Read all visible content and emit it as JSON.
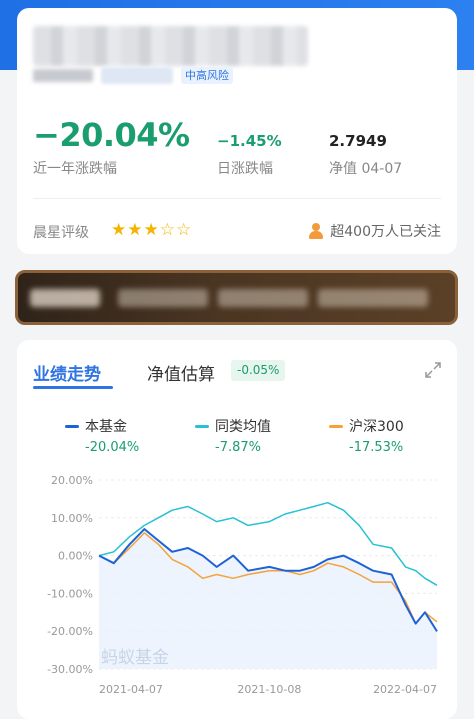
{
  "header": {
    "risk_tag": "中高风险"
  },
  "summary": {
    "return_1y": "−20.04%",
    "return_1y_label": "近一年涨跌幅",
    "daily_change": "−1.45%",
    "daily_change_label": "日涨跌幅",
    "nav": "2.7949",
    "nav_label": "净值 04-07",
    "rating_label": "晨星评级",
    "rating_stars": 3,
    "rating_max": 5,
    "followers": "超400万人已关注"
  },
  "chart_tabs": {
    "performance": "业绩走势",
    "estimate": "净值估算",
    "estimate_badge": "-0.05%"
  },
  "legend": [
    {
      "name": "本基金",
      "value": "-20.04%",
      "color": "#1e63d6"
    },
    {
      "name": "同类均值",
      "value": "-7.87%",
      "color": "#26c1d4"
    },
    {
      "name": "沪深300",
      "value": "-17.53%",
      "color": "#f4a23a"
    }
  ],
  "watermark": "蚂蚁基金",
  "colors": {
    "accent": "#2f74e0",
    "negative": "#1a9d6f",
    "fund": "#1e63d6",
    "category": "#26c1d4",
    "index": "#f4a23a"
  },
  "chart_data": {
    "type": "line",
    "y_ticks": [
      "20.00%",
      "10.00%",
      "0.00%",
      "-10.00%",
      "-20.00%",
      "-30.00%"
    ],
    "x_ticks": [
      "2021-04-07",
      "2021-10-08",
      "2022-04-07"
    ],
    "ylim": [
      -30,
      20
    ],
    "xlim": [
      "2021-04-07",
      "2022-04-07"
    ],
    "grid": true,
    "series": [
      {
        "name": "本基金",
        "x": [
          "2021-04-07",
          "2021-04-23",
          "2021-05-10",
          "2021-05-26",
          "2021-06-10",
          "2021-06-25",
          "2021-07-12",
          "2021-07-28",
          "2021-08-12",
          "2021-08-30",
          "2021-09-15",
          "2021-10-08",
          "2021-10-25",
          "2021-11-10",
          "2021-11-25",
          "2021-12-10",
          "2021-12-27",
          "2022-01-13",
          "2022-01-28",
          "2022-02-17",
          "2022-03-04",
          "2022-03-15",
          "2022-03-25",
          "2022-04-07"
        ],
        "values": [
          0,
          -2,
          3,
          7,
          4,
          1,
          2,
          0,
          -3,
          0,
          -4,
          -3,
          -4,
          -4,
          -3,
          -1,
          0,
          -2,
          -4,
          -5,
          -13,
          -18,
          -15,
          -20.04
        ]
      },
      {
        "name": "同类均值",
        "x": [
          "2021-04-07",
          "2021-04-23",
          "2021-05-10",
          "2021-05-26",
          "2021-06-10",
          "2021-06-25",
          "2021-07-12",
          "2021-07-28",
          "2021-08-12",
          "2021-08-30",
          "2021-09-15",
          "2021-10-08",
          "2021-10-25",
          "2021-11-10",
          "2021-11-25",
          "2021-12-10",
          "2021-12-27",
          "2022-01-13",
          "2022-01-28",
          "2022-02-17",
          "2022-03-04",
          "2022-03-15",
          "2022-03-25",
          "2022-04-07"
        ],
        "values": [
          0,
          1,
          5,
          8,
          10,
          12,
          13,
          11,
          9,
          10,
          8,
          9,
          11,
          12,
          13,
          14,
          12,
          8,
          3,
          2,
          -3,
          -4,
          -6,
          -7.87
        ]
      },
      {
        "name": "沪深300",
        "x": [
          "2021-04-07",
          "2021-04-23",
          "2021-05-10",
          "2021-05-26",
          "2021-06-10",
          "2021-06-25",
          "2021-07-12",
          "2021-07-28",
          "2021-08-12",
          "2021-08-30",
          "2021-09-15",
          "2021-10-08",
          "2021-10-25",
          "2021-11-10",
          "2021-11-25",
          "2021-12-10",
          "2021-12-27",
          "2022-01-13",
          "2022-01-28",
          "2022-02-17",
          "2022-03-04",
          "2022-03-15",
          "2022-03-25",
          "2022-04-07"
        ],
        "values": [
          0,
          -2,
          2,
          6,
          3,
          -1,
          -3,
          -6,
          -5,
          -6,
          -5,
          -4,
          -4,
          -5,
          -4,
          -2,
          -3,
          -5,
          -7,
          -7,
          -12,
          -18,
          -15,
          -17.53
        ]
      }
    ]
  }
}
